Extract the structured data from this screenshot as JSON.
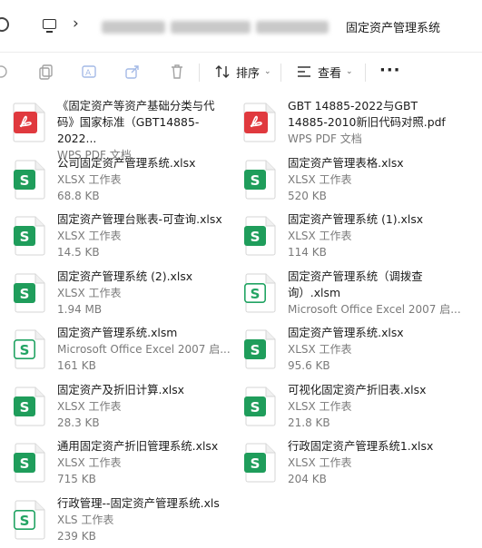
{
  "address_bar": {
    "breadcrumb_current": "固定资产管理系统",
    "icons": [
      "refresh-icon",
      "monitor-icon",
      "chevron-right-icon"
    ]
  },
  "toolbar": {
    "sort_label": "排序",
    "view_label": "查看",
    "more_label": "···",
    "icons": [
      "copy-icon",
      "paste-icon",
      "rename-icon",
      "share-icon",
      "delete-icon",
      "sort-icon",
      "view-icon"
    ]
  },
  "files": [
    {
      "name": "《固定资产等资产基础分类与代码》国家标准（GBT14885-2022...",
      "type": "WPS PDF 文档",
      "size": "",
      "kind": "pdf"
    },
    {
      "name": "GBT 14885-2022与GBT 14885-2010新旧代码对照.pdf",
      "type": "WPS PDF 文档",
      "size": "",
      "kind": "pdf"
    },
    {
      "name": "公司固定资产管理系统.xlsx",
      "type": "XLSX 工作表",
      "size": "68.8 KB",
      "kind": "xlsx"
    },
    {
      "name": "固定资产管理表格.xlsx",
      "type": "XLSX 工作表",
      "size": "520 KB",
      "kind": "xlsx"
    },
    {
      "name": "固定资产管理台账表-可查询.xlsx",
      "type": "XLSX 工作表",
      "size": "14.5 KB",
      "kind": "xlsx"
    },
    {
      "name": "固定资产管理系统 (1).xlsx",
      "type": "XLSX 工作表",
      "size": "114 KB",
      "kind": "xlsx"
    },
    {
      "name": "固定资产管理系统 (2).xlsx",
      "type": "XLSX 工作表",
      "size": "1.94 MB",
      "kind": "xlsx"
    },
    {
      "name": "固定资产管理系统（调拨查询）.xlsm",
      "type": "Microsoft Office Excel 2007 启...",
      "size": "",
      "kind": "xlsm"
    },
    {
      "name": "固定资产管理系统.xlsm",
      "type": "Microsoft Office Excel 2007 启...",
      "size": "161 KB",
      "kind": "xlsm"
    },
    {
      "name": "固定资产管理系统.xlsx",
      "type": "XLSX 工作表",
      "size": "95.6 KB",
      "kind": "xlsx"
    },
    {
      "name": "固定资产及折旧计算.xlsx",
      "type": "XLSX 工作表",
      "size": "28.3 KB",
      "kind": "xlsx"
    },
    {
      "name": "可视化固定资产折旧表.xlsx",
      "type": "XLSX 工作表",
      "size": "21.8 KB",
      "kind": "xlsx"
    },
    {
      "name": "通用固定资产折旧管理系统.xlsx",
      "type": "XLSX 工作表",
      "size": "715 KB",
      "kind": "xlsx"
    },
    {
      "name": "行政固定资产管理系统1.xlsx",
      "type": "XLSX 工作表",
      "size": "204 KB",
      "kind": "xlsx"
    },
    {
      "name": "行政管理--固定资产管理系统.xls",
      "type": "XLS 工作表",
      "size": "239 KB",
      "kind": "xls"
    }
  ],
  "colors": {
    "pdf_red": "#e0393e",
    "sheet_green": "#1f9d5b",
    "xlsm_green_outline": "#22a463"
  }
}
